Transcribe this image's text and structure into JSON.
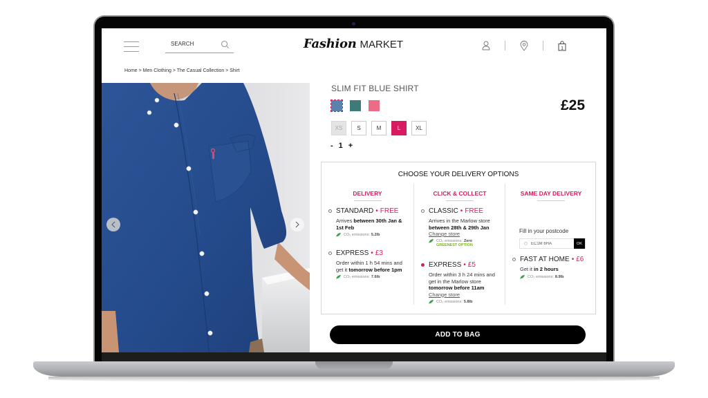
{
  "header": {
    "search_placeholder": "SEARCH",
    "logo_script": "Fashion",
    "logo_word": "MARKET",
    "bag_count": "1",
    "icons": [
      "menu-icon",
      "search-icon",
      "user-icon",
      "location-pin-icon",
      "shopping-bag-icon"
    ]
  },
  "breadcrumb": "Home > Men Clothing > The Casual Collection > Shirt",
  "product": {
    "title": "SLIM FIT BLUE SHIRT",
    "price": "£25",
    "colors": [
      {
        "name": "blue",
        "hex": "#5b82ad",
        "selected": true
      },
      {
        "name": "teal-pattern",
        "hex": "#3d7a78",
        "selected": false
      },
      {
        "name": "pink",
        "hex": "#ec6b85",
        "selected": false
      }
    ],
    "sizes": [
      {
        "label": "XS",
        "state": "disabled"
      },
      {
        "label": "S",
        "state": "available"
      },
      {
        "label": "M",
        "state": "available"
      },
      {
        "label": "L",
        "state": "selected"
      },
      {
        "label": "XL",
        "state": "available"
      }
    ],
    "quantity": {
      "minus": "-",
      "value": "1",
      "plus": "+"
    }
  },
  "delivery": {
    "title": "CHOOSE YOUR DELIVERY OPTIONS",
    "columns": [
      {
        "heading": "DELIVERY",
        "options": [
          {
            "name": "STANDARD",
            "price": "FREE",
            "desc_pre": "Arrives ",
            "desc_bold": "between 30th Jan & 1st Feb",
            "desc_post": "",
            "co2_label": "CO₂ emissions:",
            "co2_value": "5.2lb",
            "selected": false
          },
          {
            "name": "EXPRESS",
            "price": "£3",
            "desc_pre": "Order within 1 h 54 mins and get it ",
            "desc_bold": "tomorrow before 1pm",
            "desc_post": "",
            "co2_label": "CO₂ emissions:",
            "co2_value": "7.6lb",
            "selected": false
          }
        ]
      },
      {
        "heading": "CLICK & COLLECT",
        "options": [
          {
            "name": "CLASSIC",
            "price": "FREE",
            "desc_pre": "Arrives in the Marlow store ",
            "desc_bold": "between 28th & 29th Jan",
            "desc_post": "",
            "link": "Change store",
            "co2_label": "CO₂ emissions:",
            "co2_value": "Zero",
            "badge": "GREENEST OPTION",
            "selected": false
          },
          {
            "name": "EXPRESS",
            "price": "£5",
            "desc_pre": "Order within 3 h 24 mins and get in the Marlow store ",
            "desc_bold": "tomorrow before 11am",
            "desc_post": "",
            "link": "Change store",
            "co2_label": "CO₂ emissions:",
            "co2_value": "5.8lb",
            "selected": true
          }
        ]
      },
      {
        "heading": "SAME DAY DELIVERY",
        "postcode_label": "Fill in your postcode",
        "postcode_value": "EC1M 6HA",
        "ok_label": "OK",
        "options": [
          {
            "name": "FAST AT HOME",
            "price": "£6",
            "desc_pre": "Get it ",
            "desc_bold": "in 2 hours",
            "desc_post": "",
            "co2_label": "CO₂ emissions:",
            "co2_value": "8.9lb",
            "selected": false
          }
        ]
      }
    ]
  },
  "add_to_bag_label": "ADD TO BAG",
  "colors": {
    "accent": "#d81b60",
    "green": "#7cb518",
    "shirt_blue": "#2a4f8f"
  }
}
